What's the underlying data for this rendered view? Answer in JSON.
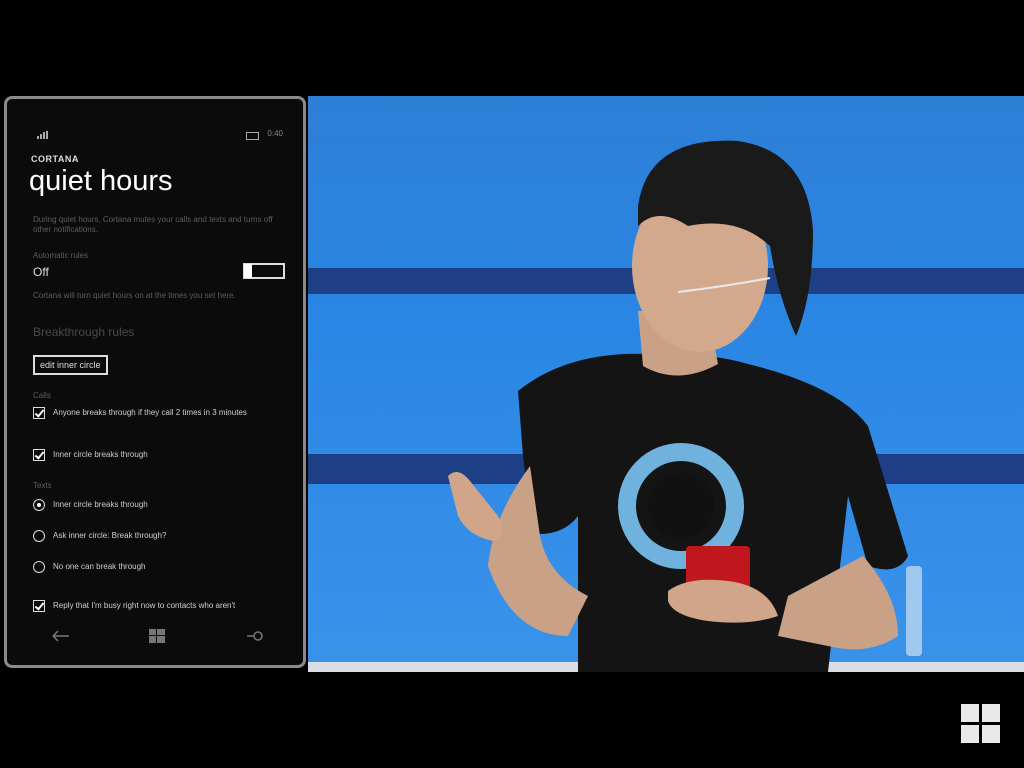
{
  "phone": {
    "status_time": "0:40",
    "app_title": "CORTANA",
    "page_title": "quiet hours",
    "description": "During quiet hours, Cortana mutes your calls and texts and turns off other notifications.",
    "automatic_rules_label": "Automatic rules",
    "automatic_rules_state": "Off",
    "automatic_rules_desc": "Cortana will turn quiet hours on at the times you set here.",
    "breakthrough_heading": "Breakthrough rules",
    "edit_inner_circle_label": "edit inner circle",
    "calls_label": "Calls",
    "calls_options": [
      {
        "text": "Anyone breaks through if they call 2 times in 3 minutes",
        "checked": true
      },
      {
        "text": "Inner circle breaks through",
        "checked": true
      }
    ],
    "texts_label": "Texts",
    "texts_options": [
      {
        "text": "Inner circle breaks through",
        "selected": true
      },
      {
        "text": "Ask inner circle: Break through?",
        "selected": false
      },
      {
        "text": "No one can break through",
        "selected": false
      }
    ],
    "reply_option": {
      "text": "Reply that I'm busy right now to contacts who aren't",
      "checked": true
    },
    "nav": {
      "back_icon": "back-arrow-icon",
      "start_icon": "windows-start-icon",
      "search_icon": "search-icon"
    }
  },
  "logo": {
    "name": "windows-logo",
    "color": "#e9e9e9"
  },
  "colors": {
    "stage_blue": "#2a86e4",
    "stage_stripe": "#1d3f86",
    "phone_bg": "#0b0b0b",
    "phone_frame": "#8a8a8a"
  }
}
